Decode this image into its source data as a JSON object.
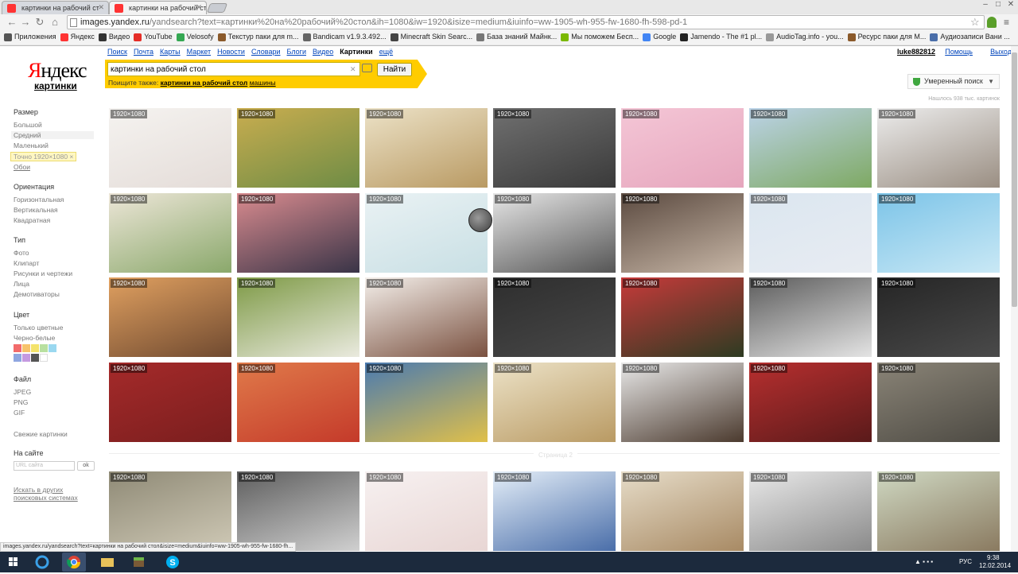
{
  "browser": {
    "tabs": [
      {
        "label": "картинки на рабочий ст"
      },
      {
        "label": "картинки на рабочий ст"
      }
    ],
    "url_host": "images.yandex.ru",
    "url_rest": "/yandsearch?text=картинки%20на%20рабочий%20стол&ih=1080&iw=1920&isize=medium&iuinfo=ww-1905-wh-955-fw-1680-fh-598-pd-1",
    "bookmarks": [
      {
        "label": "Приложения",
        "color": "#555"
      },
      {
        "label": "Яндекс",
        "color": "#ff3333"
      },
      {
        "label": "Видео",
        "color": "#333"
      },
      {
        "label": "YouTube",
        "color": "#e52d27"
      },
      {
        "label": "Velosofy",
        "color": "#35a853"
      },
      {
        "label": "Текстур паки для m...",
        "color": "#8b5a2b"
      },
      {
        "label": "Bandicam v1.9.3.492...",
        "color": "#666"
      },
      {
        "label": "Minecraft Skin Searc...",
        "color": "#444"
      },
      {
        "label": "База знаний Майнк...",
        "color": "#777"
      },
      {
        "label": "Мы поможем Бесп...",
        "color": "#7ab800"
      },
      {
        "label": "Google",
        "color": "#4285f4"
      },
      {
        "label": "Jamendo - The #1 pl...",
        "color": "#222"
      },
      {
        "label": "AudioTag.info - you...",
        "color": "#999"
      },
      {
        "label": "Ресурс паки для M...",
        "color": "#8b5a2b"
      },
      {
        "label": "Аудиозаписи Вани ...",
        "color": "#4a6ea9"
      }
    ],
    "status_url": "images.yandex.ru/yandsearch?text=картинки на рабочий стол&isize=medium&iuinfo=ww-1905-wh-955-fw-1680-fh..."
  },
  "header": {
    "logo_prefix": "Я",
    "logo_rest": "ндекс",
    "logo_sub": "картинки",
    "services": [
      "Поиск",
      "Почта",
      "Карты",
      "Маркет",
      "Новости",
      "Словари",
      "Блоги",
      "Видео",
      "Картинки",
      "ещё"
    ],
    "current_service": "Картинки",
    "username": "luke882812",
    "help": "Помощь",
    "exit": "Выход",
    "search_value": "картинки на рабочий стол",
    "search_button": "Найти",
    "try_also_prefix": "Поищите также:",
    "try_also_bold": "картинки на рабочий стол",
    "try_also_rest": "машины",
    "safe_search": "Умеренный поиск",
    "found_count": "Нашлось 938 тыс. картинок"
  },
  "filters": {
    "size_title": "Размер",
    "size_items": [
      "Большой",
      "Средний",
      "Маленький"
    ],
    "size_selected": "Средний",
    "size_chip": "Точно 1920×1080 ×",
    "size_wallpapers": "Обои",
    "orient_title": "Ориентация",
    "orient_items": [
      "Горизонтальная",
      "Вертикальная",
      "Квадратная"
    ],
    "type_title": "Тип",
    "type_items": [
      "Фото",
      "Клипарт",
      "Рисунки и чертежи",
      "Лица",
      "Демотиваторы"
    ],
    "color_title": "Цвет",
    "color_items": [
      "Только цветные",
      "Черно-белые"
    ],
    "swatches": [
      "#f26b6b",
      "#f7c36b",
      "#f4e36b",
      "#b8e0a0",
      "#9ad8f0",
      "#8fa6e0",
      "#c59ae0",
      "#555555",
      "#ffffff"
    ],
    "file_title": "Файл",
    "file_items": [
      "JPEG",
      "PNG",
      "GIF"
    ],
    "fresh": "Свежие картинки",
    "site_title": "На сайте",
    "site_placeholder": "URL сайта",
    "site_ok": "ok",
    "other_engines": "Искать в других поисковых системах"
  },
  "results": {
    "dim_label": "1920×1080",
    "page_sep": "Страница 2",
    "tiles": [
      {
        "colors": [
          "#f5f3f0",
          "#e4dcd8"
        ]
      },
      {
        "colors": [
          "#c9ad4f",
          "#6e8c45"
        ]
      },
      {
        "colors": [
          "#ece2c7",
          "#b99a63"
        ]
      },
      {
        "colors": [
          "#707070",
          "#3a3a3a"
        ]
      },
      {
        "colors": [
          "#f4c6d6",
          "#e6a6bd"
        ]
      },
      {
        "colors": [
          "#bcd3e8",
          "#7ea963"
        ]
      },
      {
        "colors": [
          "#ececec",
          "#9a8e82"
        ]
      },
      {
        "colors": [
          "#ede6d8",
          "#8aa86b"
        ]
      },
      {
        "colors": [
          "#d98b8f",
          "#393447"
        ]
      },
      {
        "colors": [
          "#eaf2f4",
          "#c8dfe4"
        ]
      },
      {
        "colors": [
          "#e6e6e6",
          "#555555"
        ]
      },
      {
        "colors": [
          "#5b4a40",
          "#c7b6a6"
        ]
      },
      {
        "colors": [
          "#dbe6f0",
          "#e8ecf2"
        ]
      },
      {
        "colors": [
          "#7cc4e8",
          "#c9e8f5"
        ]
      },
      {
        "colors": [
          "#e0a060",
          "#704a30"
        ]
      },
      {
        "colors": [
          "#7e9a46",
          "#eaeadf"
        ]
      },
      {
        "colors": [
          "#f4efea",
          "#7a5140"
        ]
      },
      {
        "colors": [
          "#2e2e2e",
          "#484848"
        ]
      },
      {
        "colors": [
          "#c73a3a",
          "#2d3b22"
        ]
      },
      {
        "colors": [
          "#5c5c5c",
          "#e4e4e4"
        ]
      },
      {
        "colors": [
          "#252525",
          "#4a4a4a"
        ]
      },
      {
        "colors": [
          "#a52a2a",
          "#7a1e1e"
        ]
      },
      {
        "colors": [
          "#e07a4a",
          "#c43a2a"
        ]
      },
      {
        "colors": [
          "#4a7ab0",
          "#e0c04a"
        ]
      },
      {
        "colors": [
          "#ece2c7",
          "#b99a63"
        ]
      },
      {
        "colors": [
          "#e8e8e8",
          "#4b3a2e"
        ]
      },
      {
        "colors": [
          "#b72f2f",
          "#5a1a1a"
        ]
      },
      {
        "colors": [
          "#8a8477",
          "#4d4a43"
        ]
      },
      {
        "colors": [
          "#8f8a76",
          "#cfc9b6"
        ]
      },
      {
        "colors": [
          "#5e5e5e",
          "#d0d0d0"
        ]
      },
      {
        "colors": [
          "#f7f1f1",
          "#e8d6d4"
        ]
      },
      {
        "colors": [
          "#e4eef8",
          "#4a6ea9"
        ]
      },
      {
        "colors": [
          "#e6dcc8",
          "#a88a64"
        ]
      },
      {
        "colors": [
          "#e8e8e8",
          "#8a8a8a"
        ]
      },
      {
        "colors": [
          "#cfd8c2",
          "#8a7a60"
        ]
      }
    ]
  },
  "taskbar": {
    "lang": "РУС",
    "time": "9:38",
    "date": "12.02.2014"
  }
}
